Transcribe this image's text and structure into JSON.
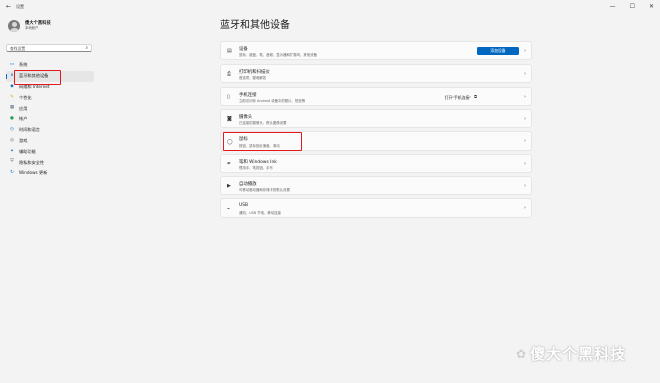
{
  "window": {
    "back_icon": "←",
    "title": "设置",
    "controls": [
      "—",
      "☐",
      "✕"
    ]
  },
  "profile": {
    "name": "傻大个黑科技",
    "subtitle": "本地帐户"
  },
  "search": {
    "placeholder": "查找设置",
    "icon": "search-icon"
  },
  "nav": [
    {
      "label": "系统",
      "icon": "system-icon",
      "glyph": "▭",
      "color": "#0078d4",
      "active": false
    },
    {
      "label": "蓝牙和其他设备",
      "icon": "bluetooth-icon",
      "glyph": "ʙ",
      "color": "#0078d4",
      "active": true
    },
    {
      "label": "网络和 Internet",
      "icon": "network-icon",
      "glyph": "◆",
      "color": "#0f6cbd",
      "active": false
    },
    {
      "label": "个性化",
      "icon": "personalization-icon",
      "glyph": "✎",
      "color": "#e3a21a",
      "active": false
    },
    {
      "label": "应用",
      "icon": "apps-icon",
      "glyph": "▦",
      "color": "#5a6c8a",
      "active": false
    },
    {
      "label": "帐户",
      "icon": "accounts-icon",
      "glyph": "●",
      "color": "#2e9e5b",
      "active": false
    },
    {
      "label": "时间和语言",
      "icon": "time-language-icon",
      "glyph": "◷",
      "color": "#0078d4",
      "active": false
    },
    {
      "label": "游戏",
      "icon": "gaming-icon",
      "glyph": "◎",
      "color": "#6b6b6b",
      "active": false
    },
    {
      "label": "辅助功能",
      "icon": "accessibility-icon",
      "glyph": "✦",
      "color": "#0078d4",
      "active": false
    },
    {
      "label": "隐私和安全性",
      "icon": "privacy-shield-icon",
      "glyph": "⛨",
      "color": "#6b6b6b",
      "active": false
    },
    {
      "label": "Windows 更新",
      "icon": "windows-update-icon",
      "glyph": "↻",
      "color": "#0078d4",
      "active": false
    }
  ],
  "main": {
    "title": "蓝牙和其他设备",
    "cards": [
      {
        "title": "设备",
        "subtitle": "鼠标、键盘、笔、音频、显示器和扩展坞、其他设备",
        "icon": "devices-icon",
        "glyph": "▤",
        "button": "添加设备"
      },
      {
        "title": "打印机和扫描仪",
        "subtitle": "首选项、疑难解答",
        "icon": "printer-icon",
        "glyph": "⎙"
      },
      {
        "title": "手机连接",
        "subtitle": "立即访问你 Android 设备中的照片、短信等",
        "icon": "phone-icon",
        "glyph": "▯",
        "link": "打开\"手机连接\""
      },
      {
        "title": "摄像头",
        "subtitle": "已连接的摄像头、默认图像设置",
        "icon": "camera-icon",
        "glyph": "◙"
      },
      {
        "title": "鼠标",
        "subtitle": "按钮、鼠标指针速度、滚动",
        "icon": "mouse-icon",
        "glyph": "◯"
      },
      {
        "title": "笔和 Windows Ink",
        "subtitle": "惯用手、笔按钮、手写",
        "icon": "pen-icon",
        "glyph": "✒"
      },
      {
        "title": "自动播放",
        "subtitle": "可移动驱动器和存储卡的默认设置",
        "icon": "autoplay-icon",
        "glyph": "▶"
      },
      {
        "title": "USB",
        "subtitle": "通知、USB 节电、移动连接",
        "icon": "usb-icon",
        "glyph": "⌁"
      }
    ],
    "chevron": "›",
    "link_icon": "⧉"
  },
  "watermark": {
    "icon": "wechat-icon",
    "text": "傻大个黑科技"
  }
}
